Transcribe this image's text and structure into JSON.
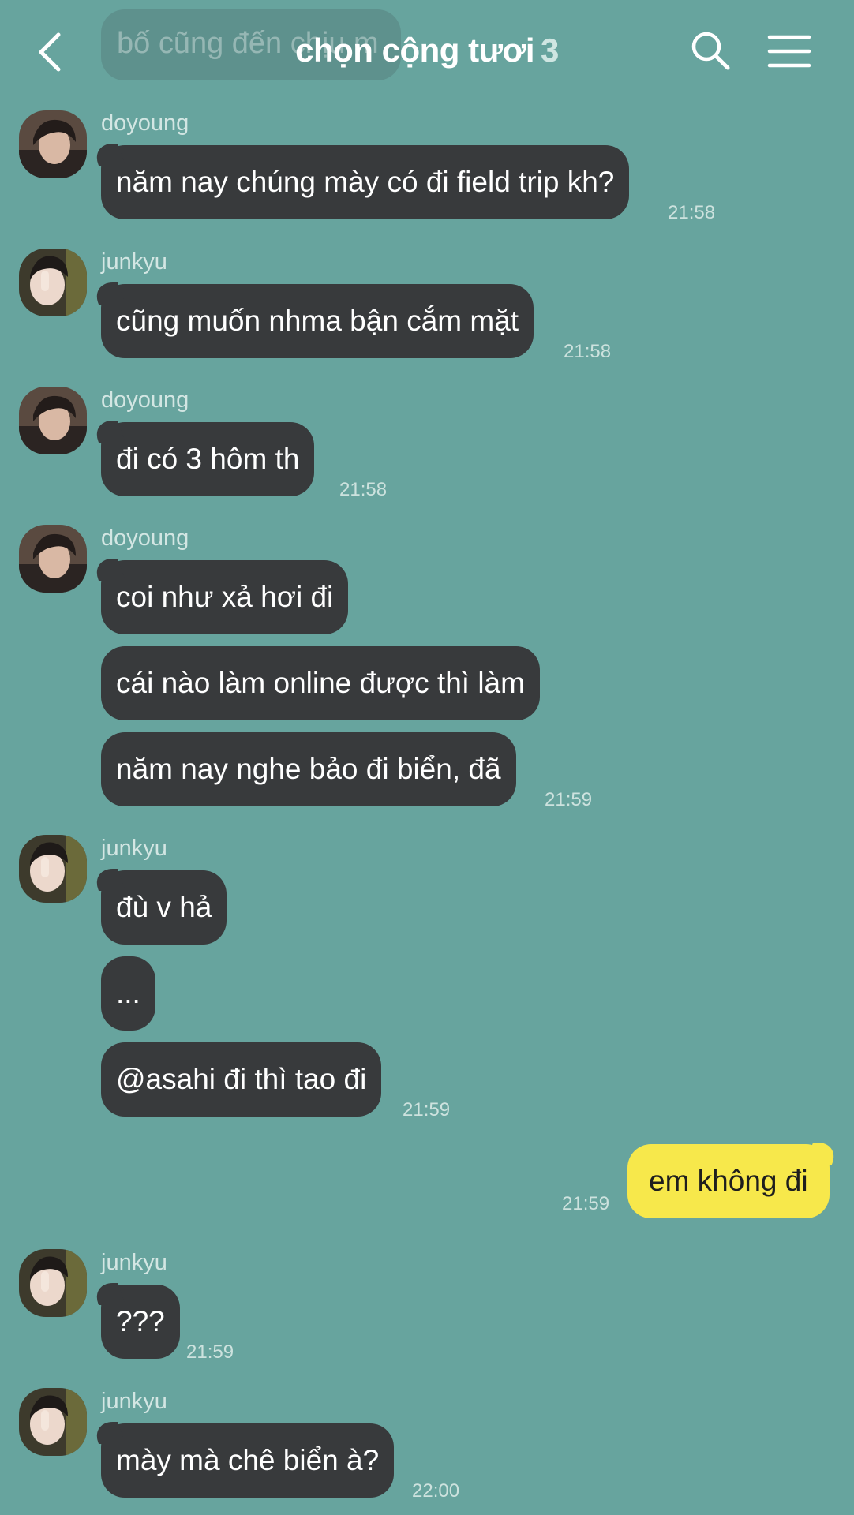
{
  "header": {
    "title": "chọn cộng tươi",
    "member_count": "3",
    "faded_previous_message": "bố cũng đến chịu m"
  },
  "messages": [
    {
      "sender": "doyoung",
      "avatar": "avatar-doyoung",
      "text": "năm nay chúng mày có đi field trip kh?",
      "time": "21:58"
    },
    {
      "sender": "junkyu",
      "avatar": "avatar-junkyu",
      "text": "cũng muốn nhma bận cắm mặt",
      "time": "21:58"
    },
    {
      "sender": "doyoung",
      "avatar": "avatar-doyoung",
      "text": "đi có 3 hôm th",
      "time": "21:58"
    },
    {
      "sender": "doyoung",
      "avatar": "avatar-doyoung",
      "text": "coi như xả hơi đi",
      "time": ""
    },
    {
      "sender": "",
      "text": "cái nào làm online được thì làm",
      "time": ""
    },
    {
      "sender": "",
      "text": "năm nay nghe bảo đi biển, đã",
      "time": "21:59"
    },
    {
      "sender": "junkyu",
      "avatar": "avatar-junkyu",
      "text": "đù v hả",
      "time": ""
    },
    {
      "sender": "",
      "text": "...",
      "time": ""
    },
    {
      "sender": "",
      "text": "@asahi đi thì tao đi",
      "time": "21:59"
    },
    {
      "sender": "me",
      "text": "em không đi",
      "time": "21:59"
    },
    {
      "sender": "junkyu",
      "avatar": "avatar-junkyu",
      "text": "???",
      "time": "21:59"
    },
    {
      "sender": "junkyu",
      "avatar": "avatar-junkyu",
      "text": "mày mà chê biển à?",
      "time": "22:00"
    }
  ],
  "icons": {
    "back": "chevron-left-icon",
    "search": "search-icon",
    "menu": "hamburger-menu-icon"
  },
  "colors": {
    "background": "#67a49e",
    "bubble_other": "#383a3c",
    "bubble_mine": "#f7e84b",
    "text_light": "#ffffff"
  }
}
